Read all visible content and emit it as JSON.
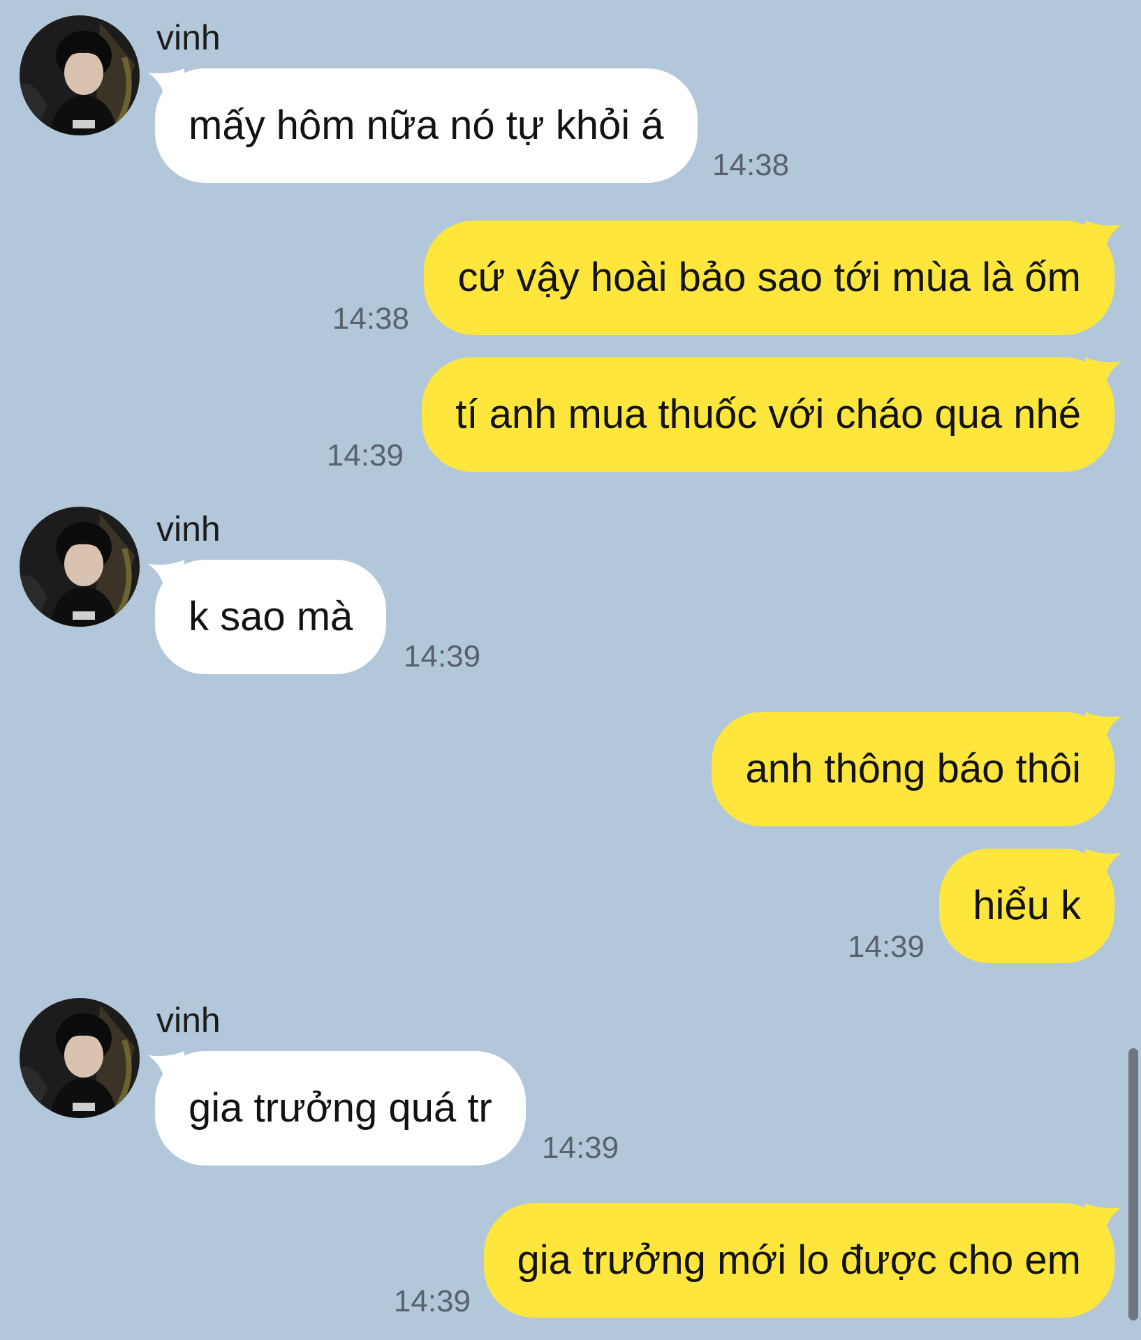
{
  "theme": {
    "background": "#b2c7d9",
    "incoming_bubble": "#ffffff",
    "outgoing_bubble": "#fee63c",
    "scrollbar": "#6f7680"
  },
  "messages": [
    {
      "direction": "in",
      "sender": "vinh",
      "avatar_icon": "contact-avatar-icon",
      "text": "mấy hôm nữa nó tự khỏi á",
      "time": "14:38"
    },
    {
      "direction": "out",
      "text": "cứ vậy hoài bảo sao tới mùa là ốm",
      "time": "14:38"
    },
    {
      "direction": "out",
      "text": "tí anh mua thuốc với cháo qua nhé",
      "time": "14:39"
    },
    {
      "direction": "in",
      "sender": "vinh",
      "avatar_icon": "contact-avatar-icon",
      "text": "k sao mà",
      "time": "14:39"
    },
    {
      "direction": "out",
      "text": "anh thông báo thôi",
      "time": ""
    },
    {
      "direction": "out",
      "text": "hiểu k",
      "time": "14:39"
    },
    {
      "direction": "in",
      "sender": "vinh",
      "avatar_icon": "contact-avatar-icon",
      "text": "gia trưởng quá tr",
      "time": "14:39"
    },
    {
      "direction": "out",
      "text": "gia trưởng mới lo được cho em",
      "time": "14:39"
    }
  ]
}
